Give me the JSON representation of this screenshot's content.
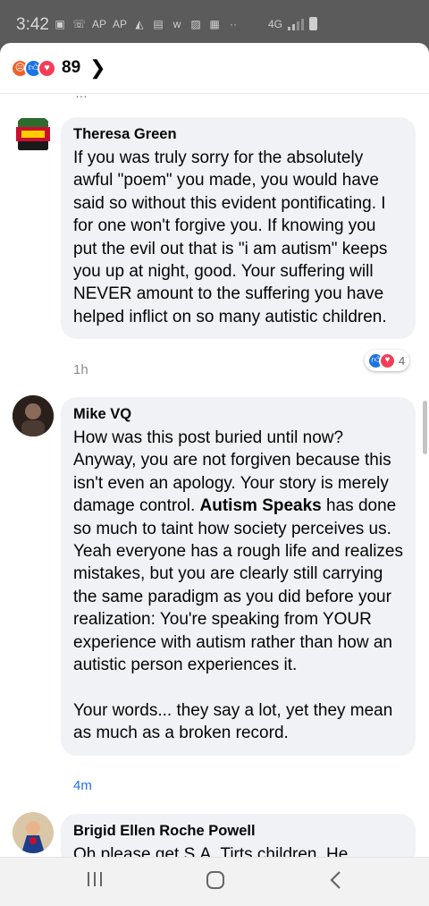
{
  "status_bar": {
    "time": "3:42",
    "icons": [
      "message-icon",
      "missed-call-icon",
      "ap-news-icon",
      "ap-news-icon",
      "image-icon",
      "news-icon",
      "wattpad-icon",
      "gallery-icon",
      "calendar-icon",
      "more-dots-icon"
    ],
    "icon_glyphs": [
      "▣",
      "☏",
      "AP",
      "AP",
      "◭",
      "▤",
      "w",
      "▨",
      "▦",
      "··"
    ],
    "network": "4G",
    "signal_level": 0.25
  },
  "reactions_header": {
    "count": "89",
    "icons": [
      "angry-reaction-icon",
      "like-reaction-icon",
      "love-reaction-icon"
    ]
  },
  "comments": [
    {
      "name": "Theresa Green",
      "text": "If you was truly sorry for the absolutely awful \"poem\" you made, you would have said so without this evident pontificating. I for one won't forgive you. If knowing you put the evil out that is \"i am autism\" keeps you up at night, good. Your suffering will NEVER amount to the suffering you have helped inflict on so many autistic children.",
      "time": "1h",
      "reaction_count": "4"
    },
    {
      "name": "Mike VQ",
      "text_parts": [
        "How was this post buried until now? Anyway, you are not forgiven because this isn't even an apology. Your story is merely damage control. ",
        "Autism Speaks",
        " has done so much to taint how society perceives us.  Yeah everyone has a rough life and realizes mistakes, but you are clearly still carrying the same paradigm as you did before your realization: You're speaking from YOUR experience with autism rather than how an autistic person experiences it.\n\nYour words... they say a lot, yet they mean as much as a broken record."
      ],
      "time": "4m"
    },
    {
      "name": "Brigid Ellen Roche Powell",
      "text": "Oh please get S.A. Tirts children. He"
    }
  ],
  "colors": {
    "bubble_bg": "#f0f2f5",
    "link_blue": "#1b74e4",
    "angry": "#f0612a",
    "like": "#1b74e4",
    "love": "#f33e58"
  }
}
